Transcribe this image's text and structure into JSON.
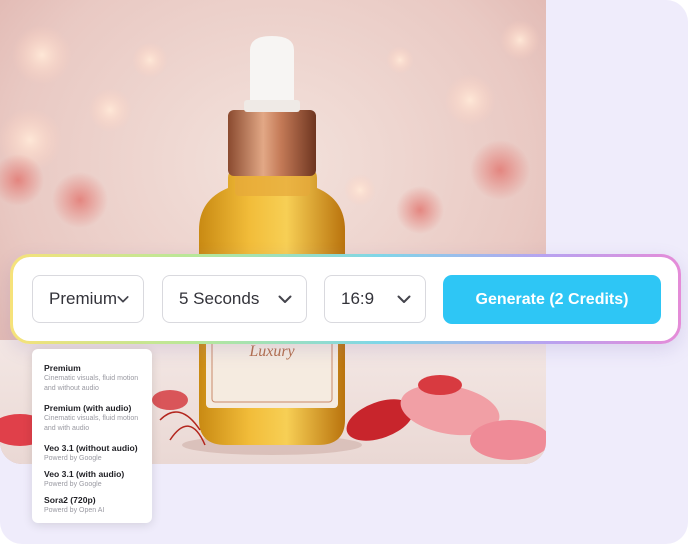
{
  "product_image": {
    "label_text": "Luxury"
  },
  "controls": {
    "quality": {
      "selected": "Premium"
    },
    "duration": {
      "selected": "5 Seconds"
    },
    "aspect_ratio": {
      "selected": "16:9"
    },
    "generate_label": "Generate (2 Credits)"
  },
  "dropdown": {
    "options": [
      {
        "title": "Premium",
        "desc": "Cinematic visuals, fluid motion and without audio"
      },
      {
        "title": "Premium (with audio)",
        "desc": "Cinematic visuals, fluid motion and with audio"
      },
      {
        "title": "Veo 3.1 (without audio)",
        "desc": "Powerd by Google"
      },
      {
        "title": "Veo 3.1 (with audio)",
        "desc": "Powerd by Google"
      },
      {
        "title": "Sora2 (720p)",
        "desc": "Powerd by Open AI"
      }
    ]
  },
  "colors": {
    "accent": "#2ec6f5",
    "panel_bg": "#efecfb"
  }
}
